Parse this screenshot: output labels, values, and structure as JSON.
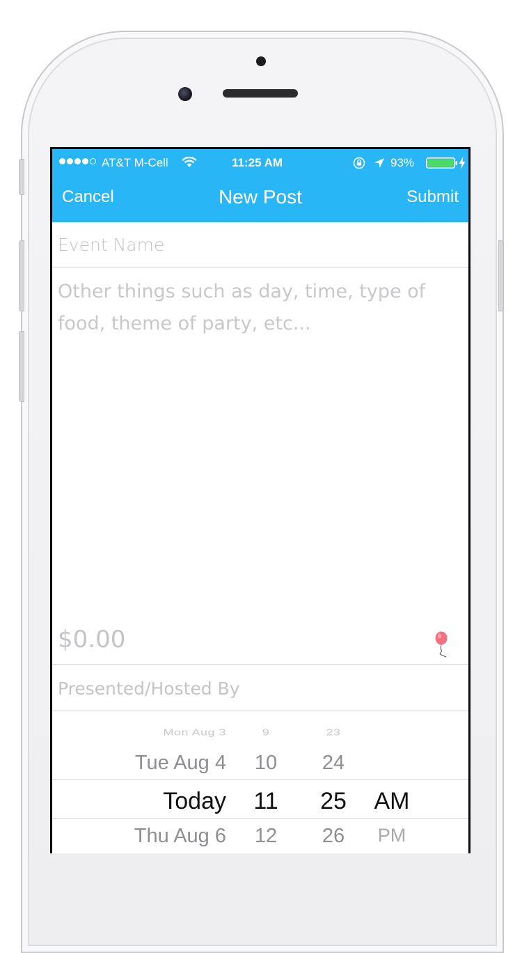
{
  "status_bar": {
    "carrier": "AT&T M-Cell",
    "time": "11:25 AM",
    "battery": "93%",
    "signal_bars_filled": 4,
    "signal_bars_total": 5,
    "battery_level": 0.93
  },
  "nav": {
    "cancel_label": "Cancel",
    "title": "New Post",
    "submit_label": "Submit",
    "accent_color": "#29b6f6"
  },
  "form": {
    "event_name": {
      "value": "",
      "placeholder": "Event Name"
    },
    "description": {
      "value": "",
      "placeholder": "Other things such as day, time, type of food, theme of party, etc..."
    },
    "price": {
      "value": "",
      "placeholder": "$0.00",
      "icon": "balloon-icon"
    },
    "hosted_by": {
      "value": "",
      "placeholder": "Presented/Hosted By"
    }
  },
  "date_picker": {
    "days": [
      "Mon Aug 3",
      "Tue Aug 4",
      "Today",
      "Thu Aug 6"
    ],
    "hours": [
      "9",
      "10",
      "11",
      "12"
    ],
    "minutes": [
      "23",
      "24",
      "25",
      "26"
    ],
    "ampm": [
      "AM",
      "PM"
    ],
    "selected": {
      "day": "Today",
      "hour": "11",
      "minute": "25",
      "ampm": "AM"
    }
  }
}
